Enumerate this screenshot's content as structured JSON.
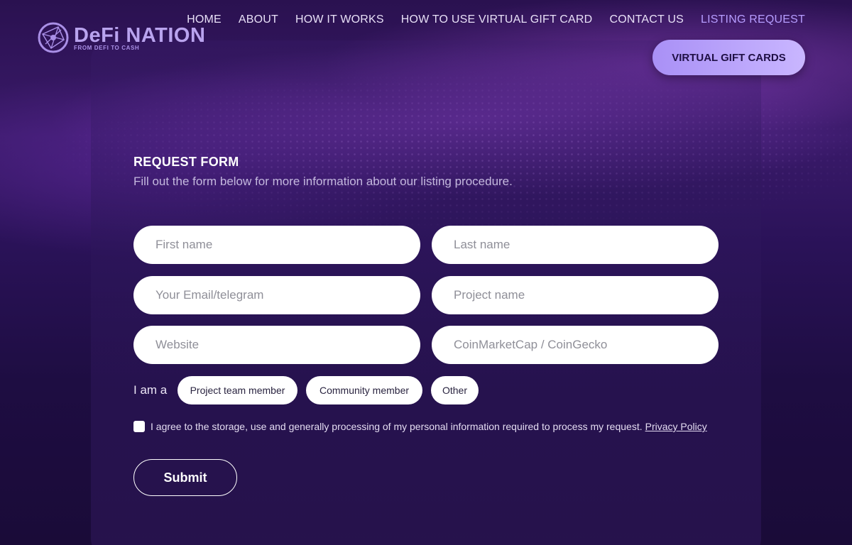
{
  "brand": {
    "name": "DeFi NATION",
    "tagline": "FROM DEFI TO CASH",
    "logo_icon": "globe-network-icon"
  },
  "nav": {
    "items": [
      {
        "label": "HOME"
      },
      {
        "label": "ABOUT"
      },
      {
        "label": "HOW IT WORKS"
      },
      {
        "label": "HOW TO USE VIRTUAL GIFT CARD"
      },
      {
        "label": "CONTACT US"
      },
      {
        "label": "LISTING REQUEST",
        "active": true
      }
    ],
    "cta_label": "VIRTUAL GIFT CARDS"
  },
  "form": {
    "title": "REQUEST FORM",
    "description": "Fill out the form below for more information about our listing procedure.",
    "fields": {
      "first_name": {
        "placeholder": "First name",
        "value": ""
      },
      "last_name": {
        "placeholder": "Last name",
        "value": ""
      },
      "email": {
        "placeholder": "Your Email/telegram",
        "value": ""
      },
      "project": {
        "placeholder": "Project name",
        "value": ""
      },
      "website": {
        "placeholder": "Website",
        "value": ""
      },
      "cmc": {
        "placeholder": "CoinMarketCap / CoinGecko",
        "value": ""
      }
    },
    "role_label": "I am a",
    "roles": [
      "Project team member",
      "Community member",
      "Other"
    ],
    "consent_text": "I agree to the storage, use and generally processing of my personal information required to process my request.",
    "privacy_link": "Privacy Policy",
    "submit_label": "Submit"
  },
  "colors": {
    "accent": "#b69dff",
    "cta_gradient_start": "#a990f6",
    "cta_gradient_end": "#c9b6ff",
    "background": "#1d0c3c"
  }
}
